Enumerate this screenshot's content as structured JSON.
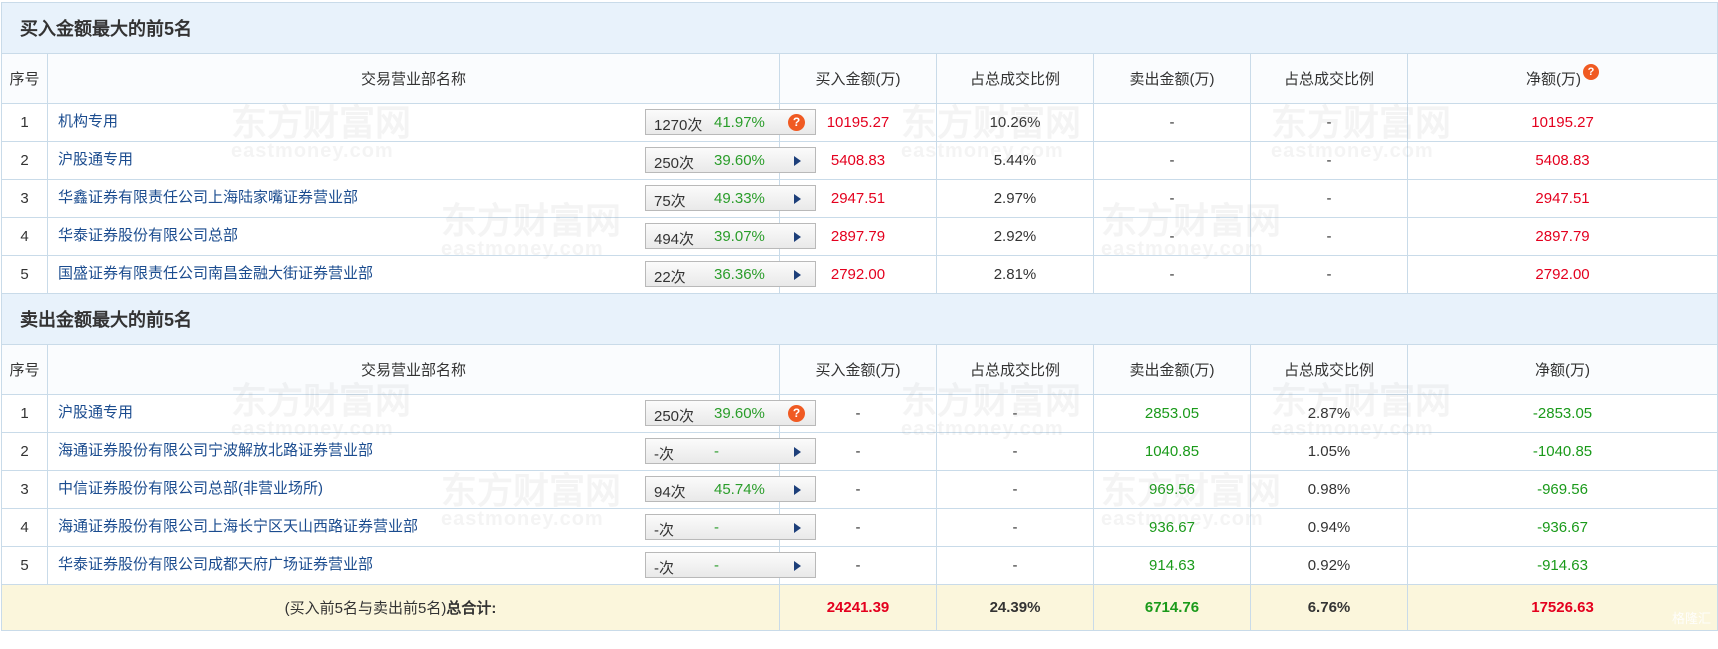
{
  "buy_section": {
    "title": "买入金额最大的前5名",
    "headers": [
      "序号",
      "交易营业部名称",
      "买入金额(万)",
      "占总成交比例",
      "卖出金额(万)",
      "占总成交比例",
      "净额(万)"
    ],
    "rows": [
      {
        "idx": "1",
        "name": "机构专用",
        "count": "1270次",
        "rate": "41.97%",
        "icon": "question-icon",
        "buy": "10195.27",
        "buy_pct": "10.26%",
        "sell": "-",
        "sell_pct": "-",
        "net": "10195.27"
      },
      {
        "idx": "2",
        "name": "沪股通专用",
        "count": "250次",
        "rate": "39.60%",
        "icon": "arrow-right-icon",
        "buy": "5408.83",
        "buy_pct": "5.44%",
        "sell": "-",
        "sell_pct": "-",
        "net": "5408.83"
      },
      {
        "idx": "3",
        "name": "华鑫证券有限责任公司上海陆家嘴证券营业部",
        "count": "75次",
        "rate": "49.33%",
        "icon": "arrow-right-icon",
        "buy": "2947.51",
        "buy_pct": "2.97%",
        "sell": "-",
        "sell_pct": "-",
        "net": "2947.51"
      },
      {
        "idx": "4",
        "name": "华泰证券股份有限公司总部",
        "count": "494次",
        "rate": "39.07%",
        "icon": "arrow-right-icon",
        "buy": "2897.79",
        "buy_pct": "2.92%",
        "sell": "-",
        "sell_pct": "-",
        "net": "2897.79"
      },
      {
        "idx": "5",
        "name": "国盛证券有限责任公司南昌金融大街证券营业部",
        "count": "22次",
        "rate": "36.36%",
        "icon": "arrow-right-icon",
        "buy": "2792.00",
        "buy_pct": "2.81%",
        "sell": "-",
        "sell_pct": "-",
        "net": "2792.00"
      }
    ]
  },
  "sell_section": {
    "title": "卖出金额最大的前5名",
    "headers": [
      "序号",
      "交易营业部名称",
      "买入金额(万)",
      "占总成交比例",
      "卖出金额(万)",
      "占总成交比例",
      "净额(万)"
    ],
    "rows": [
      {
        "idx": "1",
        "name": "沪股通专用",
        "count": "250次",
        "rate": "39.60%",
        "icon": "question-icon",
        "buy": "-",
        "buy_pct": "-",
        "sell": "2853.05",
        "sell_pct": "2.87%",
        "net": "-2853.05"
      },
      {
        "idx": "2",
        "name": "海通证券股份有限公司宁波解放北路证券营业部",
        "count": "-次",
        "rate": "-",
        "icon": "arrow-right-icon",
        "buy": "-",
        "buy_pct": "-",
        "sell": "1040.85",
        "sell_pct": "1.05%",
        "net": "-1040.85"
      },
      {
        "idx": "3",
        "name": "中信证券股份有限公司总部(非营业场所)",
        "count": "94次",
        "rate": "45.74%",
        "icon": "arrow-right-icon",
        "buy": "-",
        "buy_pct": "-",
        "sell": "969.56",
        "sell_pct": "0.98%",
        "net": "-969.56"
      },
      {
        "idx": "4",
        "name": "海通证券股份有限公司上海长宁区天山西路证券营业部",
        "count": "-次",
        "rate": "-",
        "icon": "arrow-right-icon",
        "buy": "-",
        "buy_pct": "-",
        "sell": "936.67",
        "sell_pct": "0.94%",
        "net": "-936.67"
      },
      {
        "idx": "5",
        "name": "华泰证券股份有限公司成都天府广场证券营业部",
        "count": "-次",
        "rate": "-",
        "icon": "arrow-right-icon",
        "buy": "-",
        "buy_pct": "-",
        "sell": "914.63",
        "sell_pct": "0.92%",
        "net": "-914.63"
      }
    ]
  },
  "total": {
    "label_prefix": "(买入前5名与卖出前5名)",
    "label_bold": "总合计:",
    "buy": "24241.39",
    "buy_pct": "24.39%",
    "sell": "6714.76",
    "sell_pct": "6.76%",
    "net": "17526.63"
  },
  "header_help_icon": "?",
  "row_help_icon": "?",
  "watermark": {
    "cn": "东方财富网",
    "en": "eastmoney.com"
  },
  "corner_logo": "格隆汇",
  "colors": {
    "positive": "#e4001e",
    "negative": "#1a9a1a",
    "link": "#1b4c8f",
    "header_bg": "#e8f2fb",
    "total_bg": "#fbf6dc",
    "help_icon": "#f05a22"
  }
}
